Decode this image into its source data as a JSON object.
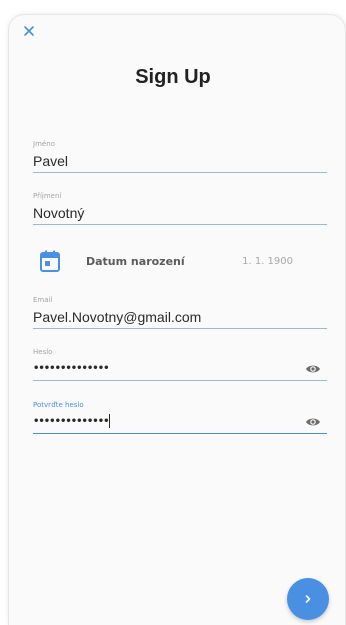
{
  "form": {
    "title": "Sign Up",
    "first_name": {
      "label": "Jméno",
      "value": "Pavel"
    },
    "last_name": {
      "label": "Příjmení",
      "value": "Novotný"
    },
    "birth_date": {
      "label": "Datum narození",
      "value": "1. 1. 1900"
    },
    "email": {
      "label": "Email",
      "value": "Pavel.Novotny@gmail.com"
    },
    "password": {
      "label": "Heslo",
      "value": "••••••••••••••"
    },
    "confirm_password": {
      "label": "Potvrďte heslo",
      "value": "••••••••••••••"
    }
  },
  "icons": {
    "close": "close-icon",
    "calendar": "calendar-icon",
    "eye": "eye-icon",
    "next": "chevron-right-icon"
  },
  "colors": {
    "accent": "#4a90e2",
    "underline": "#9bb8cc",
    "label": "#a3a3a3"
  }
}
